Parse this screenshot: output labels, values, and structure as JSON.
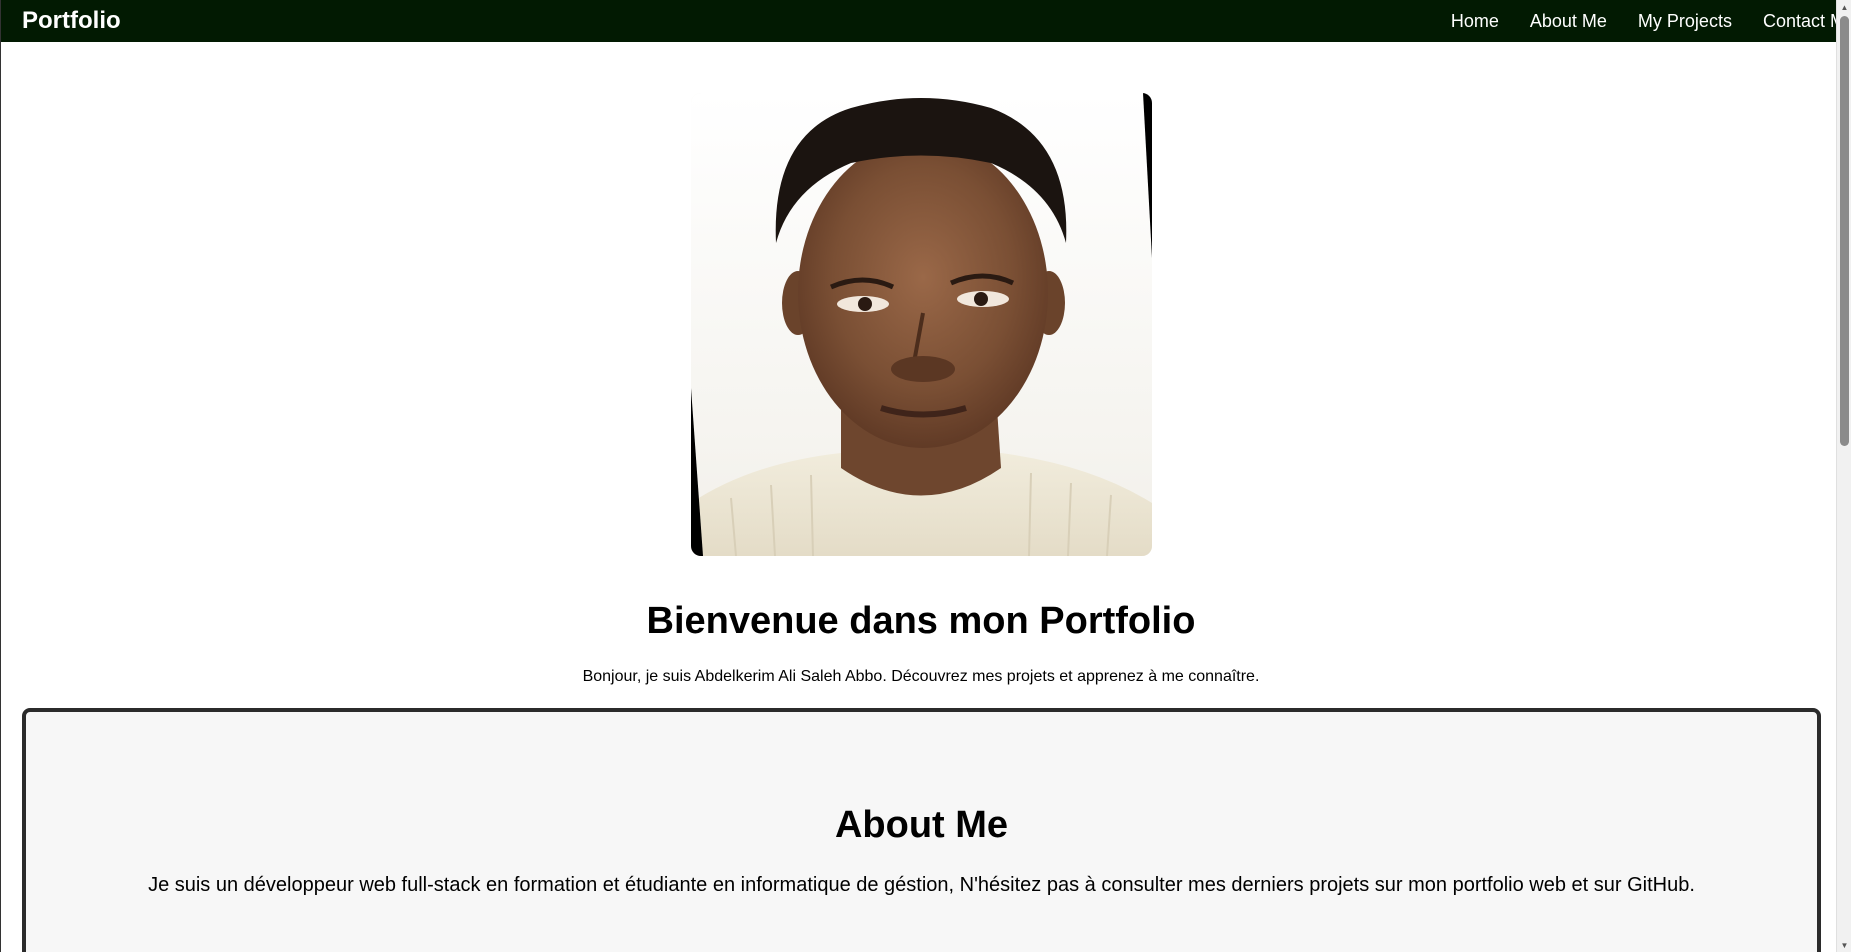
{
  "navbar": {
    "brand": "Portfolio",
    "links": [
      "Home",
      "About Me",
      "My Projects",
      "Contact Me"
    ]
  },
  "hero": {
    "photo_icon": "profile-photo",
    "title": "Bienvenue dans mon Portfolio",
    "text": "Bonjour, je suis Abdelkerim Ali Saleh Abbo. Découvrez mes projets et apprenez à me connaître."
  },
  "about": {
    "title": "About Me",
    "text": "Je suis un développeur web full-stack en formation et étudiante en informatique de géstion, N'hésitez pas à consulter mes derniers projets sur mon portfolio web et sur GitHub."
  },
  "colors": {
    "navbar_bg": "#021a02",
    "about_bg": "#f7f7f7",
    "about_border": "#2b2b2b"
  }
}
